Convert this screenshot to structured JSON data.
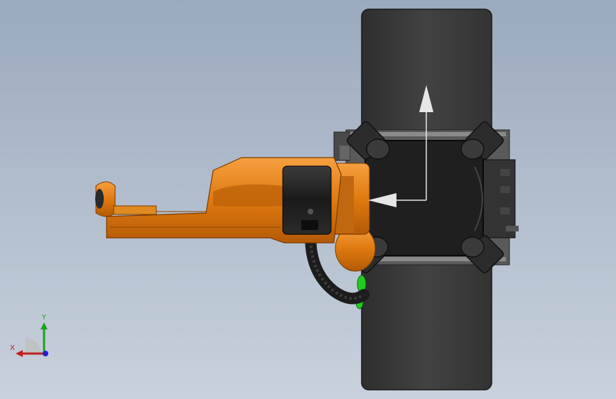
{
  "viewport": {
    "background_top": "#9aa9bd",
    "background_bottom": "#c8d1dc"
  },
  "model": {
    "arm_color": "#e07a10",
    "arm_shadow": "#b85e08",
    "track_color": "#3a3a3a",
    "base_color": "#2a2a2a",
    "accent_green": "#22cc22",
    "view_arrow_color": "#e6e6e6"
  },
  "triad": {
    "x_label": "X",
    "y_label": "Y",
    "x_color": "#c02020",
    "y_color": "#20a020",
    "z_color": "#2020d0"
  }
}
